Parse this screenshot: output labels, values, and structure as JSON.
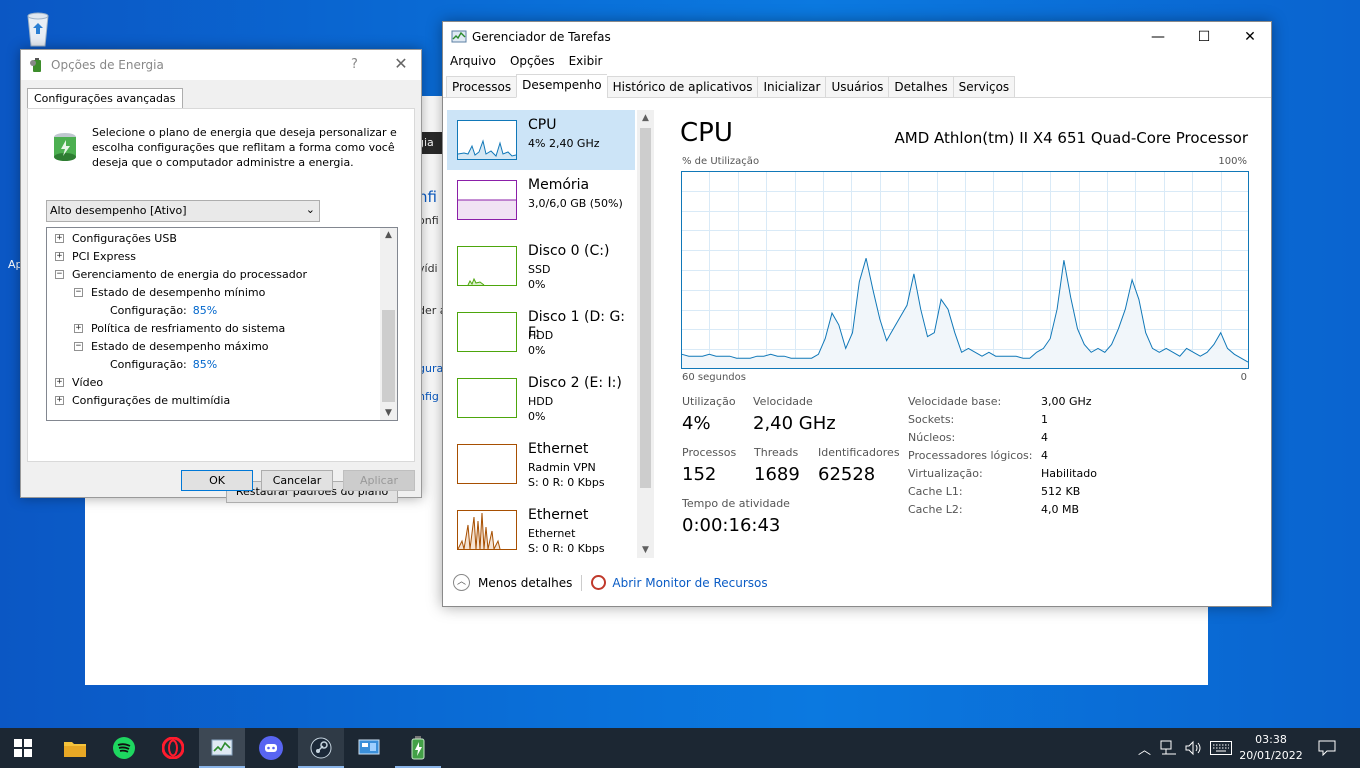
{
  "colors": {
    "accent": "#0078d7",
    "cpu": "#1178b8",
    "memory": "#8b1fa8",
    "disk": "#4da60c",
    "ethernet": "#a74f01"
  },
  "power": {
    "title": "Opções de Energia",
    "help": "?",
    "tab": "Configurações avançadas",
    "description": "Selecione o plano de energia que deseja personalizar e escolha configurações que reflitam a forma como você deseja que o computador administre a energia.",
    "plan": "Alto desempenho [Ativo]",
    "tree": [
      {
        "label": "Configurações USB",
        "expander": "+"
      },
      {
        "label": "PCI Express",
        "expander": "+"
      },
      {
        "label": "Gerenciamento de energia do processador",
        "expander": "−"
      },
      {
        "label": "Estado de desempenho mínimo",
        "expander": "−"
      },
      {
        "label": "Configuração:",
        "value": "85%"
      },
      {
        "label": "Política de resfriamento do sistema",
        "expander": "+"
      },
      {
        "label": "Estado de desempenho máximo",
        "expander": "−"
      },
      {
        "label": "Configuração:",
        "value": "85%"
      },
      {
        "label": "Vídeo",
        "expander": "+"
      },
      {
        "label": "Configurações de multimídia",
        "expander": "+"
      }
    ],
    "restore": "Restaurar padrões do plano",
    "ok": "OK",
    "cancel": "Cancelar",
    "apply": "Aplicar"
  },
  "bgwindow": {
    "dark_text": "gia",
    "frags": [
      "nfi",
      "onfi",
      "vídi",
      "der a",
      "gura",
      "nfig"
    ]
  },
  "desktop": {
    "letter": "Ap"
  },
  "taskmgr": {
    "title": "Gerenciador de Tarefas",
    "menu": [
      "Arquivo",
      "Opções",
      "Exibir"
    ],
    "tabs": [
      "Processos",
      "Desempenho",
      "Histórico de aplicativos",
      "Inicializar",
      "Usuários",
      "Detalhes",
      "Serviços"
    ],
    "side": [
      {
        "name": "CPU",
        "l2": "4% 2,40 GHz",
        "l3": ""
      },
      {
        "name": "Memória",
        "l2": "3,0/6,0 GB (50%)",
        "l3": ""
      },
      {
        "name": "Disco 0 (C:)",
        "l2": "SSD",
        "l3": "0%"
      },
      {
        "name": "Disco 1 (D: G: F:",
        "l2": "HDD",
        "l3": "0%"
      },
      {
        "name": "Disco 2 (E: I:)",
        "l2": "HDD",
        "l3": "0%"
      },
      {
        "name": "Ethernet",
        "l2": "Radmin VPN",
        "l3": "S: 0 R: 0 Kbps"
      },
      {
        "name": "Ethernet",
        "l2": "Ethernet",
        "l3": "S: 0 R: 0 Kbps"
      }
    ],
    "main": {
      "title": "CPU",
      "processor": "AMD Athlon(tm) II X4 651 Quad-Core Processor",
      "util_label": "% de Utilização",
      "max_label": "100%",
      "time_left": "60 segundos",
      "time_right": "0",
      "stats": {
        "util_label": "Utilização",
        "util": "4%",
        "speed_label": "Velocidade",
        "speed": "2,40 GHz",
        "proc_label": "Processos",
        "proc": "152",
        "threads_label": "Threads",
        "threads": "1689",
        "handles_label": "Identificadores",
        "handles": "62528",
        "uptime_label": "Tempo de atividade",
        "uptime": "0:00:16:43"
      },
      "specs": [
        {
          "k": "Velocidade base:",
          "v": "3,00 GHz"
        },
        {
          "k": "Sockets:",
          "v": "1"
        },
        {
          "k": "Núcleos:",
          "v": "4"
        },
        {
          "k": "Processadores lógicos:",
          "v": "4"
        },
        {
          "k": "Virtualização:",
          "v": "Habilitado"
        },
        {
          "k": "Cache L1:",
          "v": "512 KB"
        },
        {
          "k": "Cache L2:",
          "v": "4,0 MB"
        }
      ]
    },
    "footer": {
      "less": "Menos detalhes",
      "monitor": "Abrir Monitor de Recursos"
    },
    "cpu_history": [
      7,
      6,
      6,
      6,
      7,
      6,
      6,
      6,
      5,
      5,
      5,
      6,
      6,
      7,
      6,
      6,
      5,
      5,
      5,
      5,
      7,
      15,
      28,
      22,
      10,
      18,
      44,
      56,
      40,
      25,
      14,
      20,
      26,
      32,
      48,
      30,
      16,
      18,
      35,
      30,
      18,
      8,
      10,
      8,
      6,
      8,
      6,
      6,
      6,
      6,
      5,
      5,
      8,
      10,
      15,
      30,
      55,
      36,
      20,
      12,
      8,
      10,
      8,
      12,
      20,
      30,
      45,
      35,
      18,
      10,
      8,
      10,
      8,
      6,
      10,
      8,
      6,
      8,
      12,
      18,
      10,
      7,
      5,
      3
    ]
  },
  "taskbar": {
    "apps": [
      "start-icon",
      "file-explorer-icon",
      "spotify-icon",
      "opera-icon",
      "task-manager-icon",
      "discord-icon",
      "steam-icon",
      "control-panel-icon",
      "power-options-icon"
    ],
    "time": "03:38",
    "date": "20/01/2022"
  }
}
